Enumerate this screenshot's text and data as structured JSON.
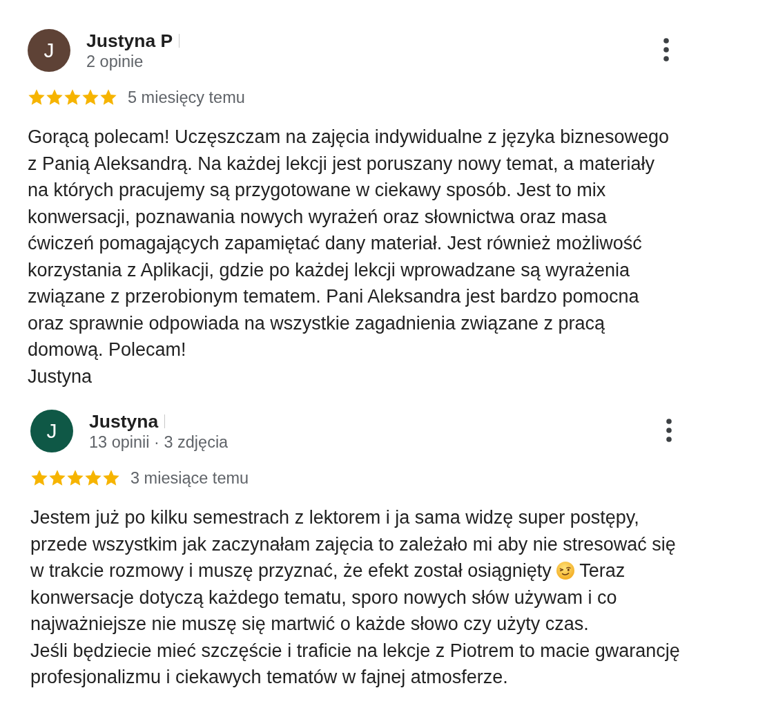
{
  "reviews": [
    {
      "author": "Justyna P",
      "initial": "J",
      "color": "#5e4236",
      "meta": "2 opinie",
      "stars": 5,
      "time": "5 miesięcy temu",
      "paragraphs": [
        [
          {
            "kind": "text",
            "text": "Gorącą polecam! Uczęszczam na zajęcia indywidualne z języka biznesowego z Panią Aleksandrą. Na każdej lekcji jest poruszany nowy temat, a materiały na których pracujemy są przygotowane w ciekawy sposób. Jest to mix konwersacji, poznawania nowych wyrażeń oraz słownictwa oraz masa ćwiczeń pomagających zapamiętać dany materiał. Jest również możliwość korzystania z Aplikacji, gdzie po każdej lekcji wprowadzane są wyrażenia związane z przerobionym tematem. Pani Aleksandra jest bardzo pomocna oraz sprawnie odpowiada na wszystkie zagadnienia związane z pracą domową. Polecam!"
          }
        ],
        [
          {
            "kind": "text",
            "text": "Justyna"
          }
        ]
      ]
    },
    {
      "author": "Justyna",
      "initial": "J",
      "color": "#0f5846",
      "meta": "13 opinii · 3 zdjęcia",
      "stars": 5,
      "time": "3 miesiące temu",
      "paragraphs": [
        [
          {
            "kind": "text",
            "text": "Jestem już po kilku semestrach z lektorem i ja sama widzę super postępy, przede wszystkim jak zaczynałam zajęcia to zależało mi aby nie stresować się w trakcie rozmowy i muszę przyznać, że efekt został osiągnięty"
          },
          {
            "kind": "emoji"
          },
          {
            "kind": "text",
            "text": "Teraz konwersacje dotyczą każdego tematu, sporo nowych słów używam i co najważniejsze nie muszę się martwić o każde słowo czy użyty czas."
          }
        ],
        [
          {
            "kind": "text",
            "text": "Jeśli będziecie mieć szczęście i traficie na lekcje z Piotrem to macie gwarancję profesjonalizmu i ciekawych tematów w fajnej atmosferze."
          }
        ]
      ]
    }
  ]
}
